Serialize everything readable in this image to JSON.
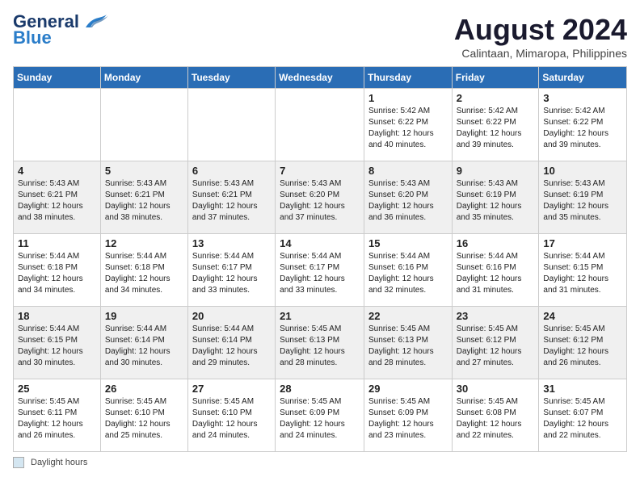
{
  "logo": {
    "line1": "General",
    "line2": "Blue"
  },
  "title": "August 2024",
  "location": "Calintaan, Mimaropa, Philippines",
  "days_of_week": [
    "Sunday",
    "Monday",
    "Tuesday",
    "Wednesday",
    "Thursday",
    "Friday",
    "Saturday"
  ],
  "legend_label": "Daylight hours",
  "weeks": [
    [
      {
        "day": "",
        "info": ""
      },
      {
        "day": "",
        "info": ""
      },
      {
        "day": "",
        "info": ""
      },
      {
        "day": "",
        "info": ""
      },
      {
        "day": "1",
        "info": "Sunrise: 5:42 AM\nSunset: 6:22 PM\nDaylight: 12 hours\nand 40 minutes."
      },
      {
        "day": "2",
        "info": "Sunrise: 5:42 AM\nSunset: 6:22 PM\nDaylight: 12 hours\nand 39 minutes."
      },
      {
        "day": "3",
        "info": "Sunrise: 5:42 AM\nSunset: 6:22 PM\nDaylight: 12 hours\nand 39 minutes."
      }
    ],
    [
      {
        "day": "4",
        "info": "Sunrise: 5:43 AM\nSunset: 6:21 PM\nDaylight: 12 hours\nand 38 minutes."
      },
      {
        "day": "5",
        "info": "Sunrise: 5:43 AM\nSunset: 6:21 PM\nDaylight: 12 hours\nand 38 minutes."
      },
      {
        "day": "6",
        "info": "Sunrise: 5:43 AM\nSunset: 6:21 PM\nDaylight: 12 hours\nand 37 minutes."
      },
      {
        "day": "7",
        "info": "Sunrise: 5:43 AM\nSunset: 6:20 PM\nDaylight: 12 hours\nand 37 minutes."
      },
      {
        "day": "8",
        "info": "Sunrise: 5:43 AM\nSunset: 6:20 PM\nDaylight: 12 hours\nand 36 minutes."
      },
      {
        "day": "9",
        "info": "Sunrise: 5:43 AM\nSunset: 6:19 PM\nDaylight: 12 hours\nand 35 minutes."
      },
      {
        "day": "10",
        "info": "Sunrise: 5:43 AM\nSunset: 6:19 PM\nDaylight: 12 hours\nand 35 minutes."
      }
    ],
    [
      {
        "day": "11",
        "info": "Sunrise: 5:44 AM\nSunset: 6:18 PM\nDaylight: 12 hours\nand 34 minutes."
      },
      {
        "day": "12",
        "info": "Sunrise: 5:44 AM\nSunset: 6:18 PM\nDaylight: 12 hours\nand 34 minutes."
      },
      {
        "day": "13",
        "info": "Sunrise: 5:44 AM\nSunset: 6:17 PM\nDaylight: 12 hours\nand 33 minutes."
      },
      {
        "day": "14",
        "info": "Sunrise: 5:44 AM\nSunset: 6:17 PM\nDaylight: 12 hours\nand 33 minutes."
      },
      {
        "day": "15",
        "info": "Sunrise: 5:44 AM\nSunset: 6:16 PM\nDaylight: 12 hours\nand 32 minutes."
      },
      {
        "day": "16",
        "info": "Sunrise: 5:44 AM\nSunset: 6:16 PM\nDaylight: 12 hours\nand 31 minutes."
      },
      {
        "day": "17",
        "info": "Sunrise: 5:44 AM\nSunset: 6:15 PM\nDaylight: 12 hours\nand 31 minutes."
      }
    ],
    [
      {
        "day": "18",
        "info": "Sunrise: 5:44 AM\nSunset: 6:15 PM\nDaylight: 12 hours\nand 30 minutes."
      },
      {
        "day": "19",
        "info": "Sunrise: 5:44 AM\nSunset: 6:14 PM\nDaylight: 12 hours\nand 30 minutes."
      },
      {
        "day": "20",
        "info": "Sunrise: 5:44 AM\nSunset: 6:14 PM\nDaylight: 12 hours\nand 29 minutes."
      },
      {
        "day": "21",
        "info": "Sunrise: 5:45 AM\nSunset: 6:13 PM\nDaylight: 12 hours\nand 28 minutes."
      },
      {
        "day": "22",
        "info": "Sunrise: 5:45 AM\nSunset: 6:13 PM\nDaylight: 12 hours\nand 28 minutes."
      },
      {
        "day": "23",
        "info": "Sunrise: 5:45 AM\nSunset: 6:12 PM\nDaylight: 12 hours\nand 27 minutes."
      },
      {
        "day": "24",
        "info": "Sunrise: 5:45 AM\nSunset: 6:12 PM\nDaylight: 12 hours\nand 26 minutes."
      }
    ],
    [
      {
        "day": "25",
        "info": "Sunrise: 5:45 AM\nSunset: 6:11 PM\nDaylight: 12 hours\nand 26 minutes."
      },
      {
        "day": "26",
        "info": "Sunrise: 5:45 AM\nSunset: 6:10 PM\nDaylight: 12 hours\nand 25 minutes."
      },
      {
        "day": "27",
        "info": "Sunrise: 5:45 AM\nSunset: 6:10 PM\nDaylight: 12 hours\nand 24 minutes."
      },
      {
        "day": "28",
        "info": "Sunrise: 5:45 AM\nSunset: 6:09 PM\nDaylight: 12 hours\nand 24 minutes."
      },
      {
        "day": "29",
        "info": "Sunrise: 5:45 AM\nSunset: 6:09 PM\nDaylight: 12 hours\nand 23 minutes."
      },
      {
        "day": "30",
        "info": "Sunrise: 5:45 AM\nSunset: 6:08 PM\nDaylight: 12 hours\nand 22 minutes."
      },
      {
        "day": "31",
        "info": "Sunrise: 5:45 AM\nSunset: 6:07 PM\nDaylight: 12 hours\nand 22 minutes."
      }
    ]
  ]
}
